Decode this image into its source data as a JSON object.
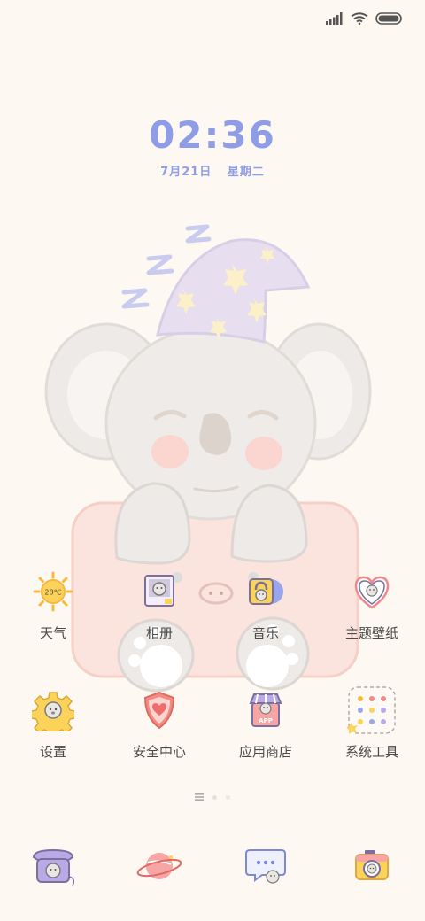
{
  "lockscreen": {
    "time": "02:36",
    "date": "7月21日",
    "weekday": "星期二"
  },
  "status_bar": {
    "icons": [
      "signal-icon",
      "wifi-icon",
      "battery-icon"
    ]
  },
  "apps": {
    "row1": [
      {
        "label": "天气",
        "icon": "weather-sun-icon",
        "badge": "28℃"
      },
      {
        "label": "相册",
        "icon": "gallery-icon"
      },
      {
        "label": "音乐",
        "icon": "music-icon"
      },
      {
        "label": "主题壁纸",
        "icon": "theme-heart-icon"
      }
    ],
    "row2": [
      {
        "label": "设置",
        "icon": "settings-gear-icon"
      },
      {
        "label": "安全中心",
        "icon": "security-shield-icon"
      },
      {
        "label": "应用商店",
        "icon": "app-store-icon",
        "badge": "APP"
      },
      {
        "label": "系统工具",
        "icon": "system-tools-folder-icon"
      }
    ]
  },
  "dock": [
    {
      "name": "phone",
      "icon": "phone-icon"
    },
    {
      "name": "browser",
      "icon": "browser-planet-icon"
    },
    {
      "name": "messages",
      "icon": "messages-icon"
    },
    {
      "name": "camera",
      "icon": "camera-icon"
    }
  ],
  "colors": {
    "background": "#fdf8f2",
    "clock": "#8f9ce6",
    "label": "#4a4a4a"
  }
}
